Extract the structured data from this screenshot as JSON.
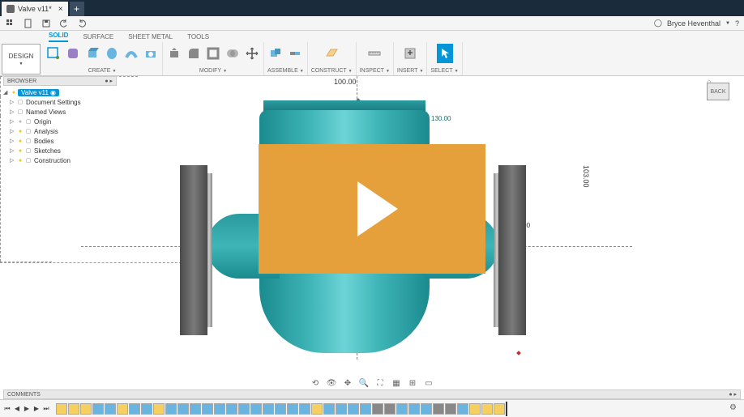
{
  "tab": {
    "title": "Valve v11*"
  },
  "user": {
    "name": "Bryce Heventhal"
  },
  "workspace": {
    "label": "DESIGN"
  },
  "ribbon_tabs": {
    "solid": "SOLID",
    "surface": "SURFACE",
    "sheet_metal": "SHEET METAL",
    "tools": "TOOLS"
  },
  "ribbon_groups": {
    "create": "CREATE",
    "modify": "MODIFY",
    "assemble": "ASSEMBLE",
    "construct": "CONSTRUCT",
    "inspect": "INSPECT",
    "insert": "INSERT",
    "select": "SELECT"
  },
  "browser": {
    "title": "BROWSER",
    "root": "Valve v11",
    "items": [
      {
        "label": "Document Settings"
      },
      {
        "label": "Named Views"
      },
      {
        "label": "Origin"
      },
      {
        "label": "Analysis"
      },
      {
        "label": "Bodies"
      },
      {
        "label": "Sketches"
      },
      {
        "label": "Construction"
      }
    ]
  },
  "dimensions": {
    "top_width": "100.00",
    "right_height": "103.00",
    "inner_1": "130.00",
    "inner_2": "130.00",
    "thick": "10.00"
  },
  "viewcube": {
    "face": "BACK"
  },
  "comments": {
    "title": "COMMENTS"
  },
  "colors": {
    "accent": "#0696d7",
    "play": "#e5a03c"
  }
}
